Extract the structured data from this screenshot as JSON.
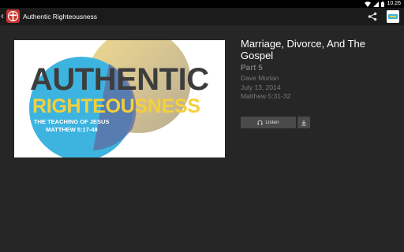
{
  "status_bar": {
    "time": "10:26"
  },
  "app_bar": {
    "title": "Authentic Righteousness"
  },
  "sermon_art": {
    "title_line1": "AUTHENTIC",
    "title_line2": "RIGHTEOUSNESS",
    "subtitle_line1": "THE TEACHING OF JESUS",
    "subtitle_line2": "MATTHEW 5:17-48",
    "colors": {
      "dark": "#3d3d3d",
      "yellow": "#f4d03c",
      "blue": "#3db4e0"
    }
  },
  "sermon": {
    "title": "Marriage, Divorce, And The Gospel",
    "part": "Part 5",
    "speaker": "Dave Morlan",
    "date": "July 13, 2014",
    "passage": "Matthew 5:31-32"
  },
  "actions": {
    "listen_label": "Listen"
  },
  "icons": [
    "back-chevron-icon",
    "church-logo-icon",
    "share-icon",
    "profile-icon",
    "headphones-icon",
    "download-icon",
    "wifi-icon",
    "signal-icon",
    "battery-icon"
  ]
}
